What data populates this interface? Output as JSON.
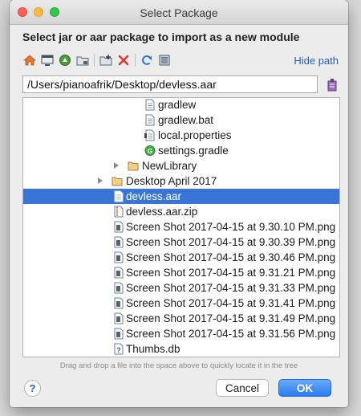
{
  "window": {
    "title": "Select Package"
  },
  "heading": "Select jar or aar package to import as a new module",
  "toolbar": {
    "icons": [
      "home-icon",
      "desktop-icon",
      "project-icon",
      "module-icon",
      "new-folder-icon",
      "delete-icon",
      "refresh-icon",
      "show-hidden-icon"
    ],
    "hide_path_label": "Hide path"
  },
  "path_field": {
    "value": "/Users/pianoafrik/Desktop/devless.aar"
  },
  "tree": {
    "rows": [
      {
        "label": "gradlew",
        "icon": "text-file-icon",
        "selected": false
      },
      {
        "label": "gradlew.bat",
        "icon": "text-file-icon",
        "selected": false
      },
      {
        "label": "local.properties",
        "icon": "properties-file-icon",
        "selected": false
      },
      {
        "label": "settings.gradle",
        "icon": "gradle-file-icon",
        "selected": false
      },
      {
        "label": "NewLibrary",
        "icon": "folder-icon",
        "selected": false
      },
      {
        "label": "Desktop April 2017",
        "icon": "folder-icon",
        "selected": false
      },
      {
        "label": "devless.aar",
        "icon": "archive-file-icon",
        "selected": true
      },
      {
        "label": "devless.aar.zip",
        "icon": "zip-file-icon",
        "selected": false
      },
      {
        "label": "Screen Shot 2017-04-15 at 9.30.10 PM.png",
        "icon": "image-file-icon",
        "selected": false
      },
      {
        "label": "Screen Shot 2017-04-15 at 9.30.39 PM.png",
        "icon": "image-file-icon",
        "selected": false
      },
      {
        "label": "Screen Shot 2017-04-15 at 9.30.46 PM.png",
        "icon": "image-file-icon",
        "selected": false
      },
      {
        "label": "Screen Shot 2017-04-15 at 9.31.21 PM.png",
        "icon": "image-file-icon",
        "selected": false
      },
      {
        "label": "Screen Shot 2017-04-15 at 9.31.33 PM.png",
        "icon": "image-file-icon",
        "selected": false
      },
      {
        "label": "Screen Shot 2017-04-15 at 9.31.41 PM.png",
        "icon": "image-file-icon",
        "selected": false
      },
      {
        "label": "Screen Shot 2017-04-15 at 9.31.49 PM.png",
        "icon": "image-file-icon",
        "selected": false
      },
      {
        "label": "Screen Shot 2017-04-15 at 9.31.56 PM.png",
        "icon": "image-file-icon",
        "selected": false
      },
      {
        "label": "Thumbs.db",
        "icon": "unknown-file-icon",
        "selected": false
      }
    ]
  },
  "hint": "Drag and drop a file into the space above to quickly locate it in the tree",
  "buttons": {
    "help": "?",
    "cancel": "Cancel",
    "ok": "OK"
  },
  "colors": {
    "selection": "#3875d7",
    "link": "#2a5db0",
    "ok_button": "#2a7cf0"
  }
}
